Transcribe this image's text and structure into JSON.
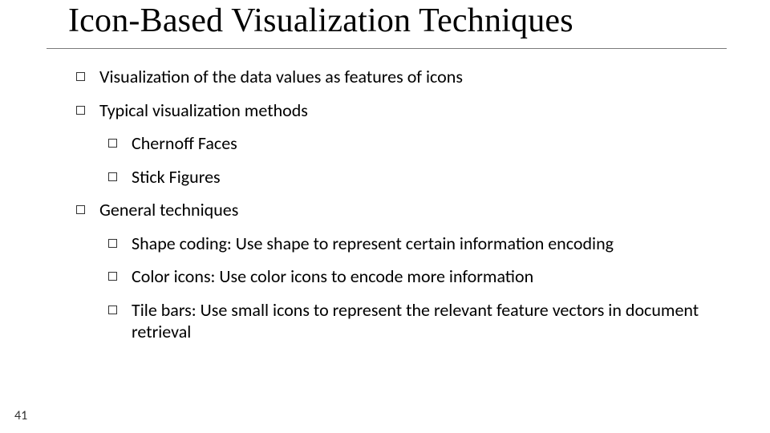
{
  "slide": {
    "title": "Icon-Based Visualization Techniques",
    "page_number": "41",
    "bullets": {
      "b1": "Visualization of the data values as features of icons",
      "b2": "Typical visualization methods",
      "b2a": "Chernoff Faces",
      "b2b": "Stick Figures",
      "b3": "General techniques",
      "b3a": "Shape coding: Use shape to represent certain information encoding",
      "b3b": "Color icons: Use color icons to encode more information",
      "b3c": "Tile bars: Use small icons to represent the relevant feature vectors in document retrieval"
    }
  }
}
